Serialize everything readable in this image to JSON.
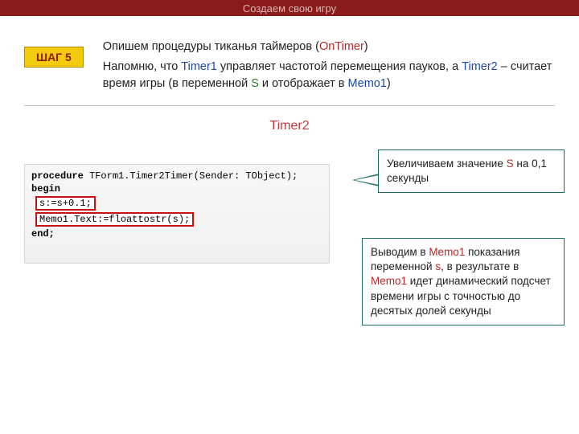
{
  "banner": "Создаем свою игру",
  "step": "ШАГ 5",
  "intro": {
    "line1_pre": "Опишем процедуры тиканья таймеров (",
    "line1_kw": "OnTimer",
    "line1_post": ")",
    "line2_p1": "Напомню, что ",
    "line2_t1": "Timer1",
    "line2_p2": "  управляет частотой перемещения пауков, а ",
    "line2_t2": "Timer2",
    "line2_p3": " – считает время игры (в переменной ",
    "line2_s": "S",
    "line2_p4": " и отображает в ",
    "line2_memo": "Memo1",
    "line2_p5": ")"
  },
  "timer_label": "Timer2",
  "code": {
    "l1_a": "procedure",
    "l1_b": " TForm1.Timer2Timer(Sender: TObject);",
    "l2": "begin",
    "l3": "s:=s+0.1;",
    "l4": "Memo1.Text:=floattostr(s);",
    "l5": "end;"
  },
  "callout1": {
    "pre": " Увеличиваем значение ",
    "s": "S",
    "post": " на 0,1 секунды"
  },
  "callout2": {
    "p1": " Выводим в ",
    "memo1a": "Memo1",
    "p2": " показания переменной ",
    "s": "s",
    "p3": ", в результате в ",
    "memo1b": "Memo1",
    "p4": " идет динамический подсчет времени игры с точностью до десятых долей секунды"
  }
}
